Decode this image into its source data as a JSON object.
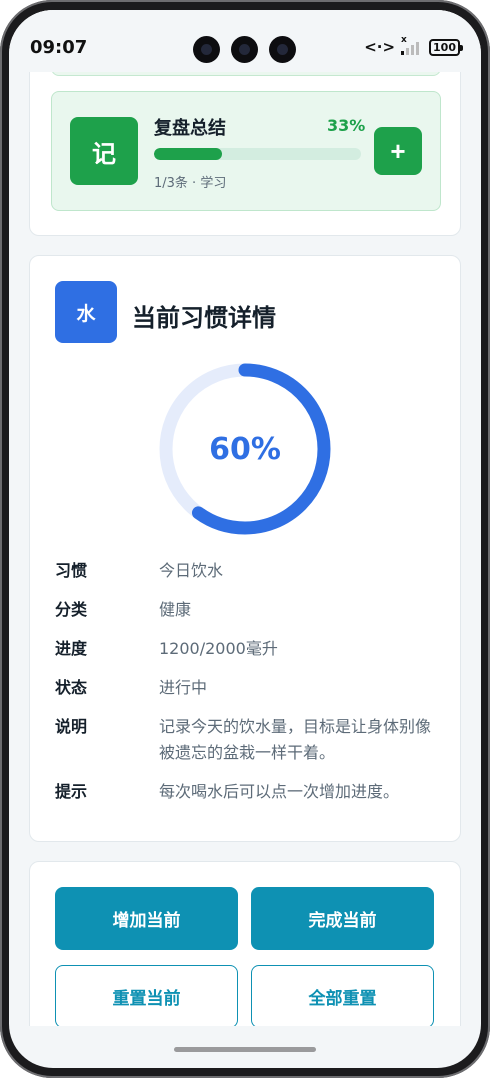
{
  "status_bar": {
    "time": "09:07",
    "battery": "100",
    "nfc_icon": "nfc-arrows-icon",
    "signal_icon": "signal-x-icon"
  },
  "habit_item": {
    "icon_char": "记",
    "name": "复盘总结",
    "percent_text": "33%",
    "progress": 0.33,
    "meta": "1/3条 · 学习",
    "add_label": "+",
    "accent": "#1ea14b"
  },
  "detail": {
    "icon_char": "水",
    "title": "当前习惯详情",
    "progress": 0.6,
    "progress_label": "60%",
    "accent": "#2f6fe3",
    "rows": [
      {
        "key": "习惯",
        "value": "今日饮水"
      },
      {
        "key": "分类",
        "value": "健康"
      },
      {
        "key": "进度",
        "value": "1200/2000毫升"
      },
      {
        "key": "状态",
        "value": "进行中"
      },
      {
        "key": "说明",
        "value": "记录今天的饮水量，目标是让身体别像被遗忘的盆栽一样干着。"
      },
      {
        "key": "提示",
        "value": "每次喝水后可以点一次增加进度。"
      }
    ]
  },
  "actions": {
    "increase": "增加当前",
    "complete": "完成当前",
    "reset_current": "重置当前",
    "reset_all": "全部重置",
    "accent": "#0e91b3"
  }
}
